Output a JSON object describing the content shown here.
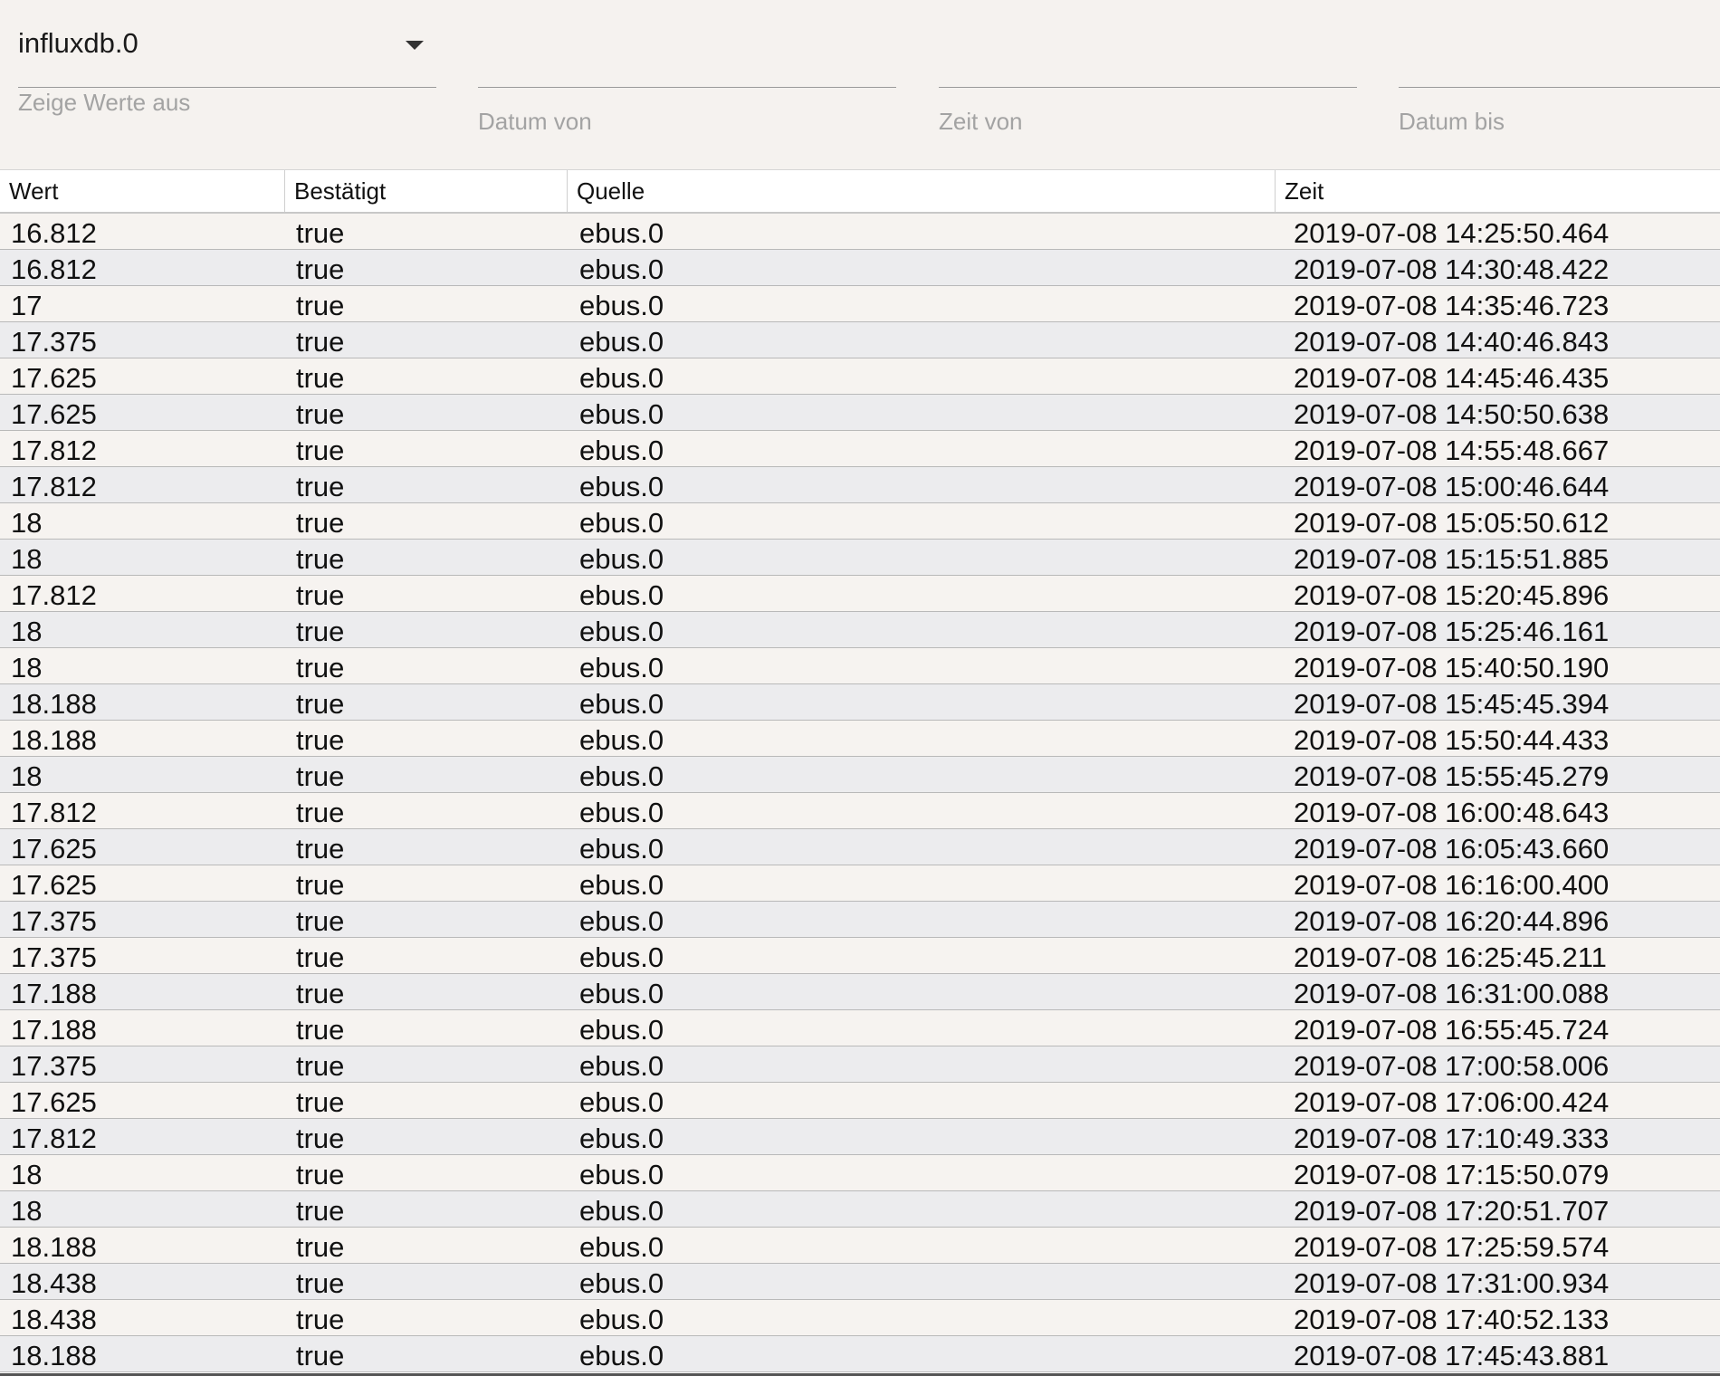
{
  "filters": {
    "instance": {
      "value": "influxdb.0",
      "label": "Zeige Werte aus"
    },
    "date_from": {
      "label": "Datum von",
      "value": ""
    },
    "time_from": {
      "label": "Zeit von",
      "value": ""
    },
    "date_to": {
      "label": "Datum bis",
      "value": ""
    }
  },
  "table": {
    "columns": [
      "Wert",
      "Bestätigt",
      "Quelle",
      "Zeit"
    ],
    "rows": [
      [
        "16.812",
        "true",
        "ebus.0",
        "2019-07-08 14:25:50.464"
      ],
      [
        "16.812",
        "true",
        "ebus.0",
        "2019-07-08 14:30:48.422"
      ],
      [
        "17",
        "true",
        "ebus.0",
        "2019-07-08 14:35:46.723"
      ],
      [
        "17.375",
        "true",
        "ebus.0",
        "2019-07-08 14:40:46.843"
      ],
      [
        "17.625",
        "true",
        "ebus.0",
        "2019-07-08 14:45:46.435"
      ],
      [
        "17.625",
        "true",
        "ebus.0",
        "2019-07-08 14:50:50.638"
      ],
      [
        "17.812",
        "true",
        "ebus.0",
        "2019-07-08 14:55:48.667"
      ],
      [
        "17.812",
        "true",
        "ebus.0",
        "2019-07-08 15:00:46.644"
      ],
      [
        "18",
        "true",
        "ebus.0",
        "2019-07-08 15:05:50.612"
      ],
      [
        "18",
        "true",
        "ebus.0",
        "2019-07-08 15:15:51.885"
      ],
      [
        "17.812",
        "true",
        "ebus.0",
        "2019-07-08 15:20:45.896"
      ],
      [
        "18",
        "true",
        "ebus.0",
        "2019-07-08 15:25:46.161"
      ],
      [
        "18",
        "true",
        "ebus.0",
        "2019-07-08 15:40:50.190"
      ],
      [
        "18.188",
        "true",
        "ebus.0",
        "2019-07-08 15:45:45.394"
      ],
      [
        "18.188",
        "true",
        "ebus.0",
        "2019-07-08 15:50:44.433"
      ],
      [
        "18",
        "true",
        "ebus.0",
        "2019-07-08 15:55:45.279"
      ],
      [
        "17.812",
        "true",
        "ebus.0",
        "2019-07-08 16:00:48.643"
      ],
      [
        "17.625",
        "true",
        "ebus.0",
        "2019-07-08 16:05:43.660"
      ],
      [
        "17.625",
        "true",
        "ebus.0",
        "2019-07-08 16:16:00.400"
      ],
      [
        "17.375",
        "true",
        "ebus.0",
        "2019-07-08 16:20:44.896"
      ],
      [
        "17.375",
        "true",
        "ebus.0",
        "2019-07-08 16:25:45.211"
      ],
      [
        "17.188",
        "true",
        "ebus.0",
        "2019-07-08 16:31:00.088"
      ],
      [
        "17.188",
        "true",
        "ebus.0",
        "2019-07-08 16:55:45.724"
      ],
      [
        "17.375",
        "true",
        "ebus.0",
        "2019-07-08 17:00:58.006"
      ],
      [
        "17.625",
        "true",
        "ebus.0",
        "2019-07-08 17:06:00.424"
      ],
      [
        "17.812",
        "true",
        "ebus.0",
        "2019-07-08 17:10:49.333"
      ],
      [
        "18",
        "true",
        "ebus.0",
        "2019-07-08 17:15:50.079"
      ],
      [
        "18",
        "true",
        "ebus.0",
        "2019-07-08 17:20:51.707"
      ],
      [
        "18.188",
        "true",
        "ebus.0",
        "2019-07-08 17:25:59.574"
      ],
      [
        "18.438",
        "true",
        "ebus.0",
        "2019-07-08 17:31:00.934"
      ],
      [
        "18.438",
        "true",
        "ebus.0",
        "2019-07-08 17:40:52.133"
      ],
      [
        "18.188",
        "true",
        "ebus.0",
        "2019-07-08 17:45:43.881"
      ]
    ]
  }
}
